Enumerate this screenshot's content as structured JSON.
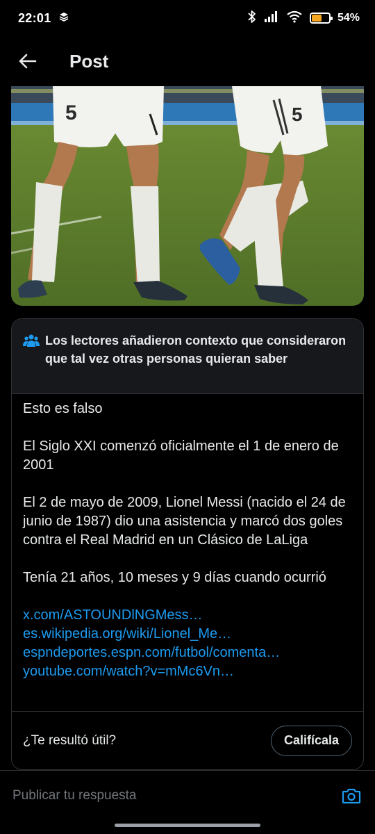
{
  "status_bar": {
    "time": "22:01",
    "battery_percent": "54",
    "battery_level": 0.54
  },
  "header": {
    "title": "Post"
  },
  "media": {
    "description_icon": "photo"
  },
  "community_note": {
    "header_text": "Los lectores añadieron contexto que consideraron que tal vez otras personas quieran saber",
    "paragraphs": [
      "Esto es falso",
      "El Siglo XXI comenzó oficialmente el 1 de enero de 2001",
      "El 2 de mayo de 2009, Lionel Messi (nacido el 24 de junio de 1987) dio una asistencia y marcó dos goles contra el Real Madrid en un Clásico de LaLiga",
      "Tenía 21 años, 10 meses y 9 días cuando ocurrió"
    ],
    "links": [
      "x.com/ASTOUNDlNGMess…",
      "es.wikipedia.org/wiki/Lionel_Me…",
      "espndeportes.espn.com/futbol/comenta…",
      "youtube.com/watch?v=mMc6Vn…"
    ],
    "helpful_question": "¿Te resultó útil?",
    "rate_button": "Califícala"
  },
  "reply": {
    "placeholder": "Publicar tu respuesta"
  },
  "colors": {
    "accent": "#1d9bf0",
    "background": "#000000",
    "battery": "#f5a623"
  }
}
